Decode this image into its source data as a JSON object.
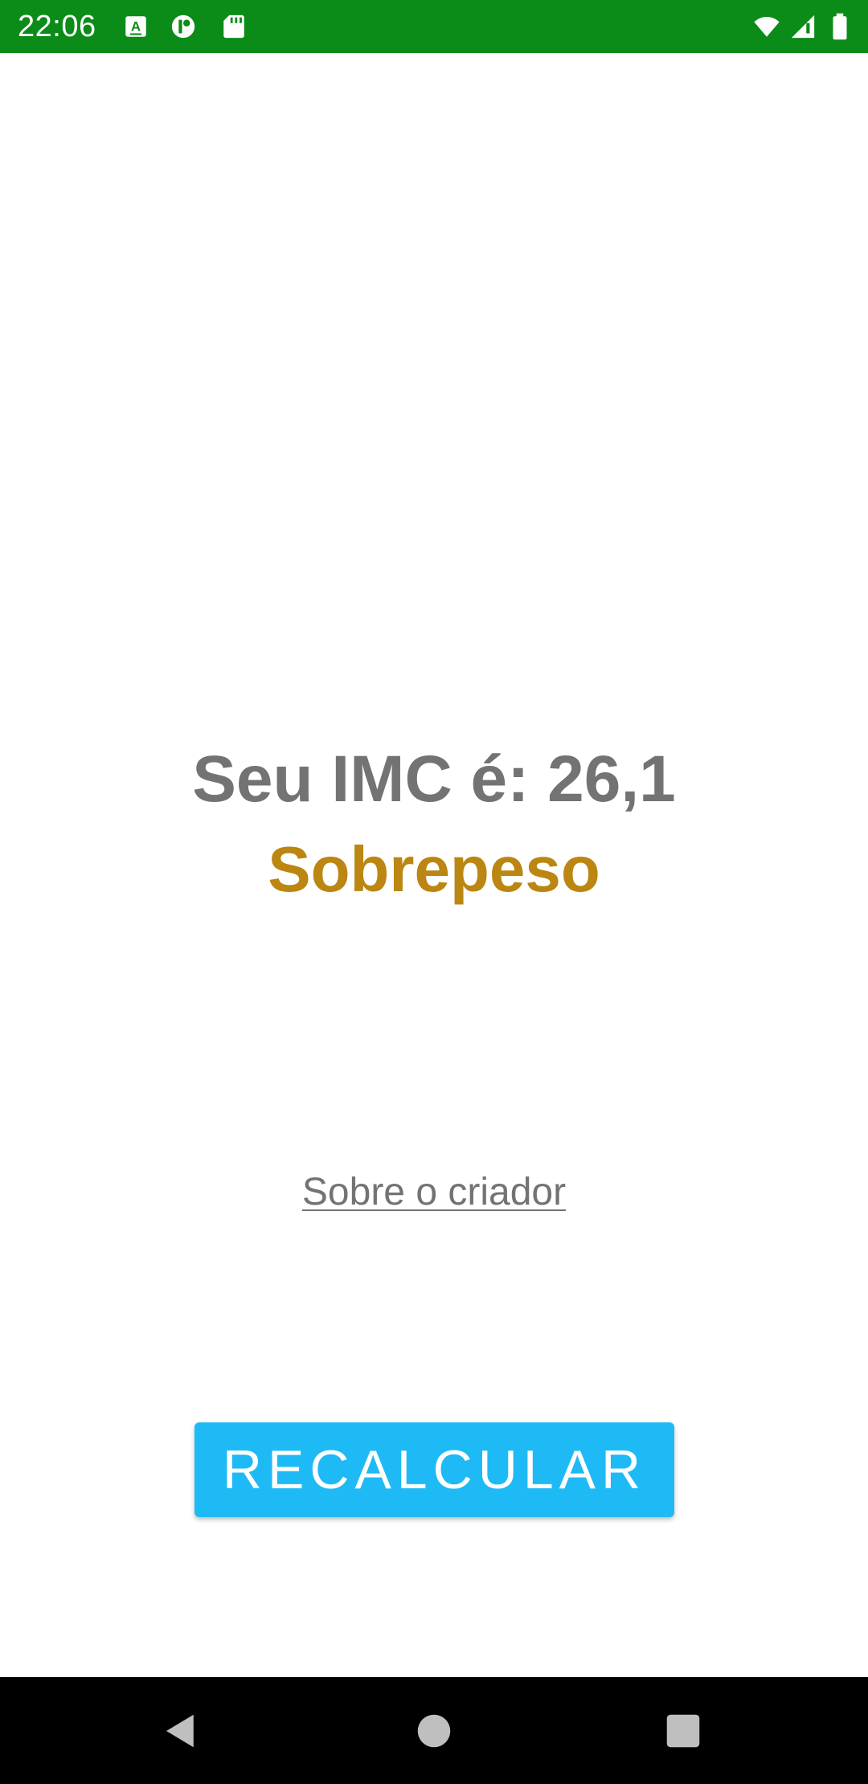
{
  "status_bar": {
    "time": "22:06",
    "background_color": "#0b8c18",
    "left_icons": [
      "text-a-notification-icon",
      "app-notification-icon",
      "sd-card-icon"
    ],
    "right_icons": [
      "wifi-icon",
      "cellular-signal-icon",
      "battery-icon"
    ]
  },
  "result": {
    "imc_text": "Seu IMC é: 26,1",
    "classification": "Sobrepeso",
    "classification_color": "#bb8611"
  },
  "about_link": {
    "label": "Sobre o criador"
  },
  "recalc_button": {
    "label": "RECALCULAR",
    "color": "#1ebaf5"
  },
  "nav_bar": {
    "buttons": [
      "back-icon",
      "home-icon",
      "recents-icon"
    ]
  }
}
